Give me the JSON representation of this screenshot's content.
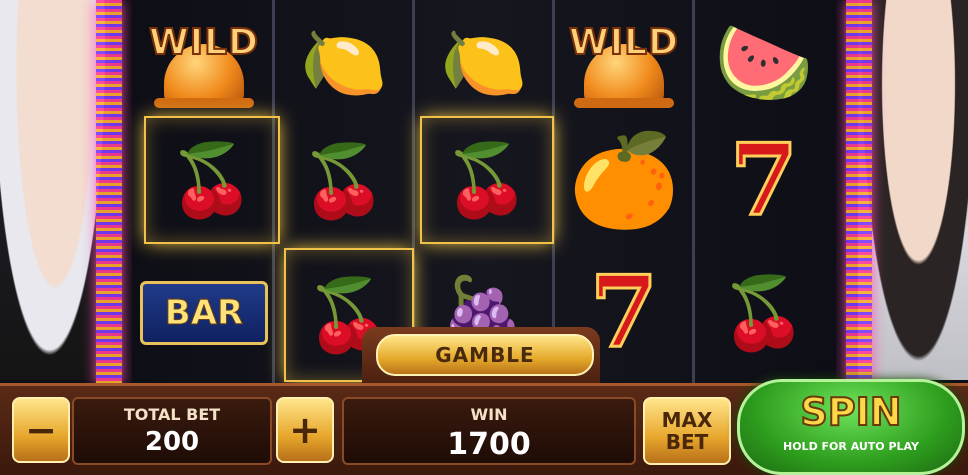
{
  "reels": [
    [
      "wild",
      "cherry",
      "bar"
    ],
    [
      "lemon",
      "cherry",
      "cherry"
    ],
    [
      "lemon",
      "cherry",
      "grapes"
    ],
    [
      "wild",
      "orange",
      "seven"
    ],
    [
      "watermelon",
      "seven",
      "cherry"
    ]
  ],
  "symbols": {
    "wild_text": "WILD",
    "bar_text": "BAR",
    "seven_text": "7",
    "cherry": "🍒",
    "lemon": "🍋",
    "grapes": "🍇",
    "orange": "🍊",
    "watermelon": "🍉"
  },
  "gamble": {
    "label": "GAMBLE"
  },
  "total_bet": {
    "label": "TOTAL BET",
    "value": "200"
  },
  "win": {
    "label": "WIN",
    "value": "1700"
  },
  "buttons": {
    "minus": "−",
    "plus": "+",
    "max_bet": "MAX\nBET"
  },
  "spin": {
    "label": "SPIN",
    "sublabel": "HOLD FOR AUTO PLAY"
  },
  "colors": {
    "highlight": "#f2c14a",
    "spin_green": "#2e9e1e",
    "gold": "#e7a72c"
  }
}
